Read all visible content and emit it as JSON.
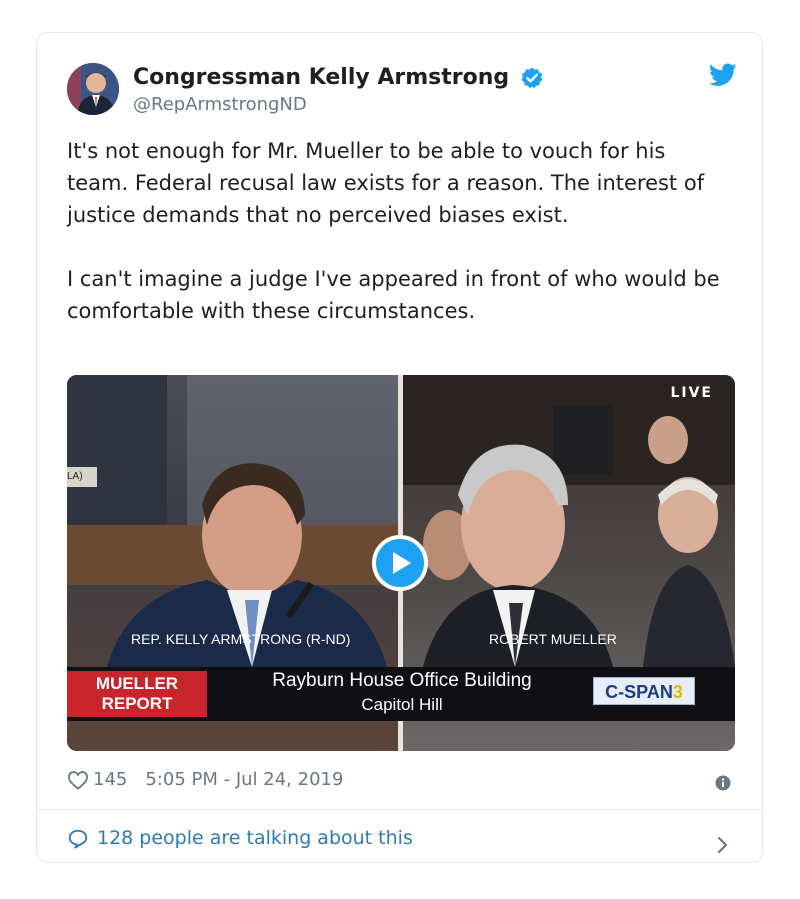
{
  "tweet": {
    "author": {
      "display_name": "Congressman Kelly Armstrong",
      "handle": "@RepArmstrongND",
      "verified": true
    },
    "text_paragraphs": [
      "It's not enough for Mr. Mueller to be able to vouch for his team. Federal recusal law exists for a reason. The interest of justice demands that no perceived biases exist.",
      "I can't imagine a judge I've appeared in front of who would be comfortable with these circumstances."
    ],
    "media": {
      "live_label": "LIVE",
      "left_name": "REP. KELLY ARMSTRONG (R-ND)",
      "right_name": "ROBERT MUELLER",
      "side_tag": "LA)",
      "report_label_line1": "MUELLER",
      "report_label_line2": "REPORT",
      "location_line1": "Rayburn House Office Building",
      "location_line2": "Capitol Hill",
      "network_prefix": "C-SPAN",
      "network_suffix": "3"
    },
    "likes": "145",
    "timestamp": "5:05 PM - Jul 24, 2019",
    "talking": "128 people are talking about this"
  },
  "colors": {
    "link": "#2b7bb9",
    "twitter_blue": "#1da1f2",
    "muted": "#697882",
    "report_red": "#c7242b"
  },
  "icons": [
    "avatar",
    "verified-badge-icon",
    "twitter-bird-icon",
    "play-icon",
    "heart-icon",
    "info-icon",
    "speech-bubble-icon",
    "chevron-right-icon"
  ]
}
